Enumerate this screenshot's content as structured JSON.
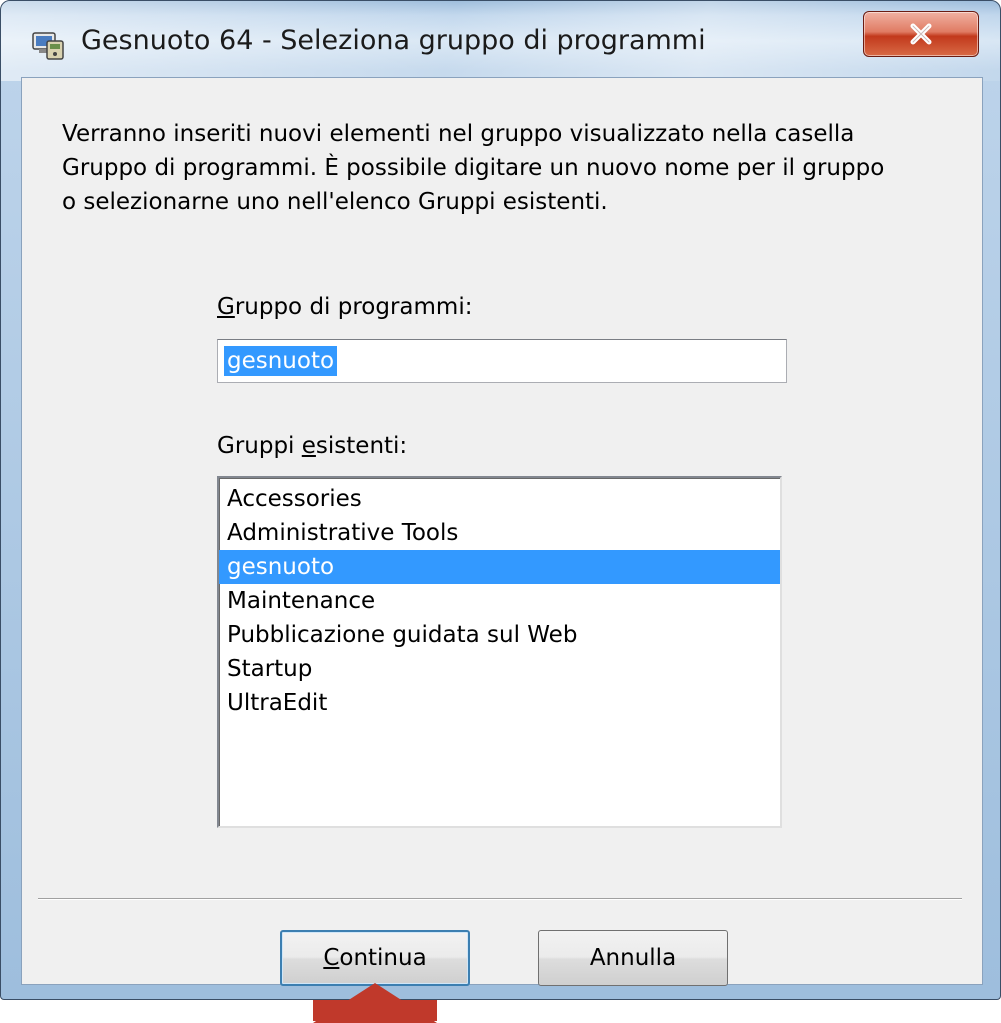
{
  "window": {
    "title": "Gesnuoto 64 - Seleziona gruppo di programmi",
    "close_label": "X"
  },
  "description": "Verranno inseriti nuovi elementi nel gruppo visualizzato nella casella\nGruppo di programmi. È possibile digitare un nuovo nome per il gruppo\no selezionarne uno nell'elenco Gruppi esistenti.",
  "program_group": {
    "label_first": "G",
    "label_rest": "ruppo di programmi:",
    "value": "gesnuoto"
  },
  "existing_groups": {
    "label_before": "Gruppi ",
    "label_accel": "e",
    "label_after": "sistenti:",
    "items": [
      "Accessories",
      "Administrative Tools",
      "gesnuoto",
      "Maintenance",
      "Pubblicazione guidata sul Web",
      "Startup",
      "UltraEdit"
    ],
    "selected_index": 2
  },
  "buttons": {
    "continue_accel": "C",
    "continue_rest": "ontinua",
    "cancel": "Annulla"
  },
  "colors": {
    "selection": "#3399ff",
    "pointer_arrow": "#c0392b"
  }
}
